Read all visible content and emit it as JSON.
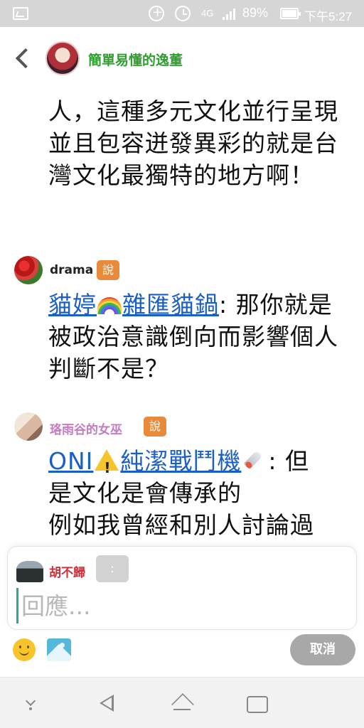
{
  "status_bar": {
    "battery": "89%",
    "time": "下午5:27",
    "network": "4G"
  },
  "header": {
    "title": "簡單易懂的逸董"
  },
  "messages": [
    {
      "text": "人，這種多元文化並行呈現並且包容迸發異彩的就是台灣文化最獨特的地方啊！"
    },
    {
      "sender": "drama",
      "sender_color": "#222222",
      "badge": "說",
      "mention": "貓婷🌈雜匯貓鍋",
      "text": ": 那你就是被政治意識倒向而影響個人判斷不是？"
    },
    {
      "sender": "珞雨谷的女巫",
      "sender_color": "#c47ac4",
      "badge": "說",
      "mention_part1": "ONI",
      "mention_part2": "純潔戰鬥機",
      "text_line1": ": 但",
      "text_line2": "是文化是會傳承的",
      "text_line3": "例如我曾經和別人討論過"
    }
  ],
  "reply": {
    "user": "胡不歸",
    "colon": ":",
    "placeholder": "回應..."
  },
  "actions": {
    "cancel": "取消"
  },
  "icons": {
    "emoji": "smiley-icon",
    "image": "image-icon",
    "back": "back-arrow-icon"
  }
}
